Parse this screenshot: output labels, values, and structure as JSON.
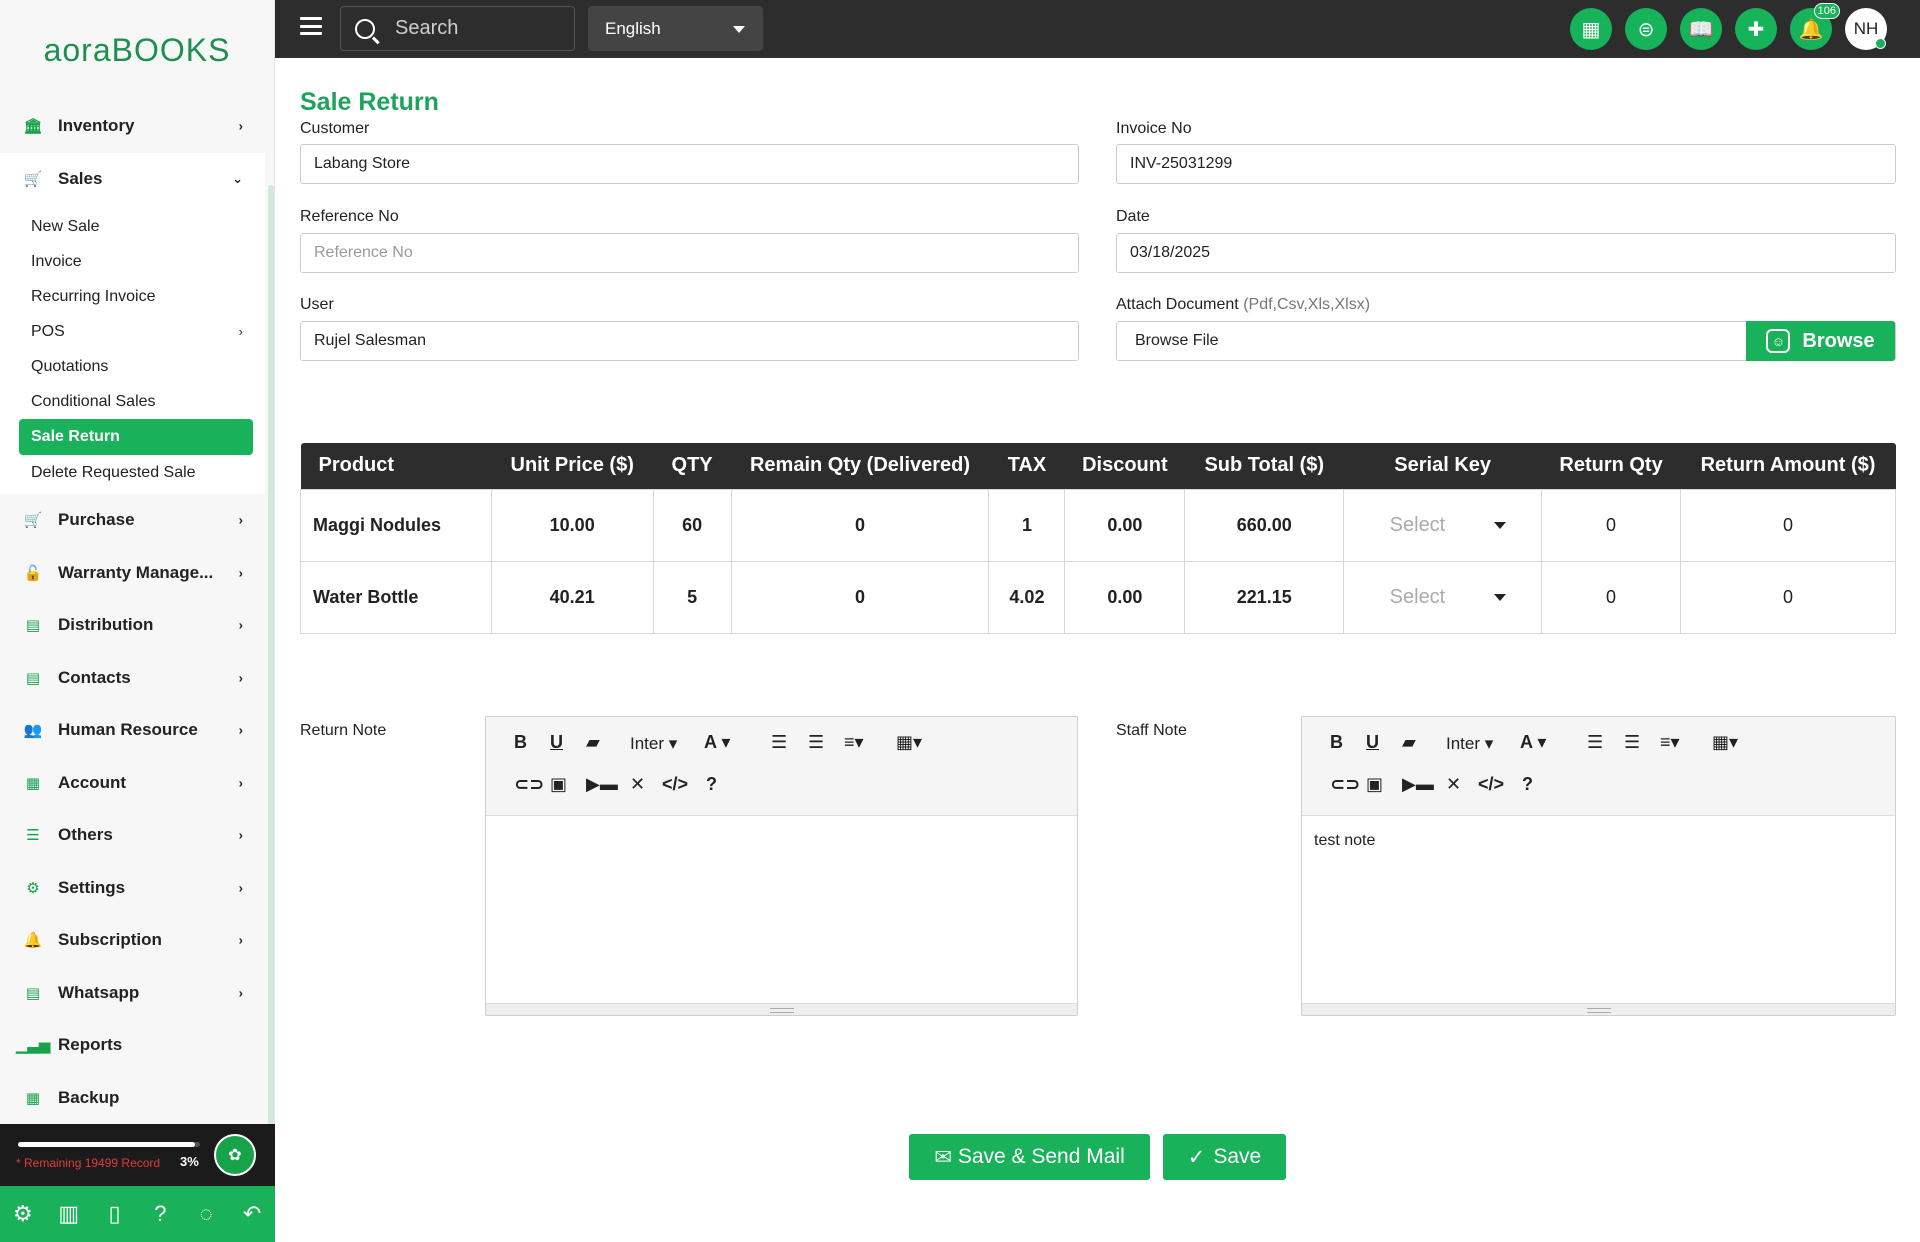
{
  "app": {
    "logo_a": "aora",
    "logo_b": "BOOKS"
  },
  "topbar": {
    "search_placeholder": "Search",
    "language": "English",
    "notification_count": "106",
    "avatar_initials": "NH"
  },
  "sidebar": {
    "items": [
      {
        "label": "Inventory",
        "icon": "bank-icon"
      },
      {
        "label": "Sales",
        "icon": "cart-icon"
      },
      {
        "label": "Purchase",
        "icon": "cart-icon"
      },
      {
        "label": "Warranty Manage...",
        "icon": "unlock-icon"
      },
      {
        "label": "Distribution",
        "icon": "document-icon"
      },
      {
        "label": "Contacts",
        "icon": "document-icon"
      },
      {
        "label": "Human Resource",
        "icon": "users-icon"
      },
      {
        "label": "Account",
        "icon": "calculator-icon"
      },
      {
        "label": "Others",
        "icon": "menu-icon"
      },
      {
        "label": "Settings",
        "icon": "gear-icon"
      },
      {
        "label": "Subscription",
        "icon": "bell-icon"
      },
      {
        "label": "Whatsapp",
        "icon": "document-icon"
      },
      {
        "label": "Reports",
        "icon": "bar-chart-icon"
      },
      {
        "label": "Backup",
        "icon": "grid-icon"
      }
    ],
    "sales_sub": [
      {
        "label": "New Sale"
      },
      {
        "label": "Invoice"
      },
      {
        "label": "Recurring Invoice"
      },
      {
        "label": "POS"
      },
      {
        "label": "Quotations"
      },
      {
        "label": "Conditional Sales"
      },
      {
        "label": "Sale Return"
      },
      {
        "label": "Delete Requested Sale"
      }
    ],
    "remaining_text": "* Remaining 19499 Record",
    "remaining_pct": "3%",
    "remaining_fraction": 0.03
  },
  "form": {
    "title": "Sale Return",
    "customer_label": "Customer",
    "customer_value": "Labang Store",
    "invoice_label": "Invoice No",
    "invoice_value": "INV-25031299",
    "reference_label": "Reference No",
    "reference_placeholder": "Reference No",
    "date_label": "Date",
    "date_value": "03/18/2025",
    "user_label": "User",
    "user_value": "Rujel Salesman",
    "attach_label": "Attach Document",
    "attach_hint": "(Pdf,Csv,Xls,Xlsx)",
    "browse_text": "Browse File",
    "browse_button": "Browse"
  },
  "table": {
    "headers": [
      "Product",
      "Unit Price ($)",
      "QTY",
      "Remain Qty (Delivered)",
      "TAX",
      "Discount",
      "Sub Total ($)",
      "Serial Key",
      "Return Qty",
      "Return Amount ($)"
    ],
    "rows": [
      {
        "product": "Maggi Nodules",
        "unit_price": "10.00",
        "qty": "60",
        "remain_qty": "0",
        "tax": "1",
        "discount": "0.00",
        "sub_total": "660.00",
        "serial_key": "Select",
        "return_qty": "0",
        "return_amount": "0"
      },
      {
        "product": "Water Bottle",
        "unit_price": "40.21",
        "qty": "5",
        "remain_qty": "0",
        "tax": "4.02",
        "discount": "0.00",
        "sub_total": "221.15",
        "serial_key": "Select",
        "return_qty": "0",
        "return_amount": "0"
      }
    ]
  },
  "notes": {
    "return_label": "Return Note",
    "staff_label": "Staff Note",
    "font_name": "Inter",
    "return_content": "",
    "staff_content": "test note"
  },
  "actions": {
    "save_send": "Save & Send Mail",
    "save": "Save"
  },
  "colors": {
    "accent": "#19b25b",
    "topbar": "#2d2d2d",
    "title": "#1fa35c"
  }
}
